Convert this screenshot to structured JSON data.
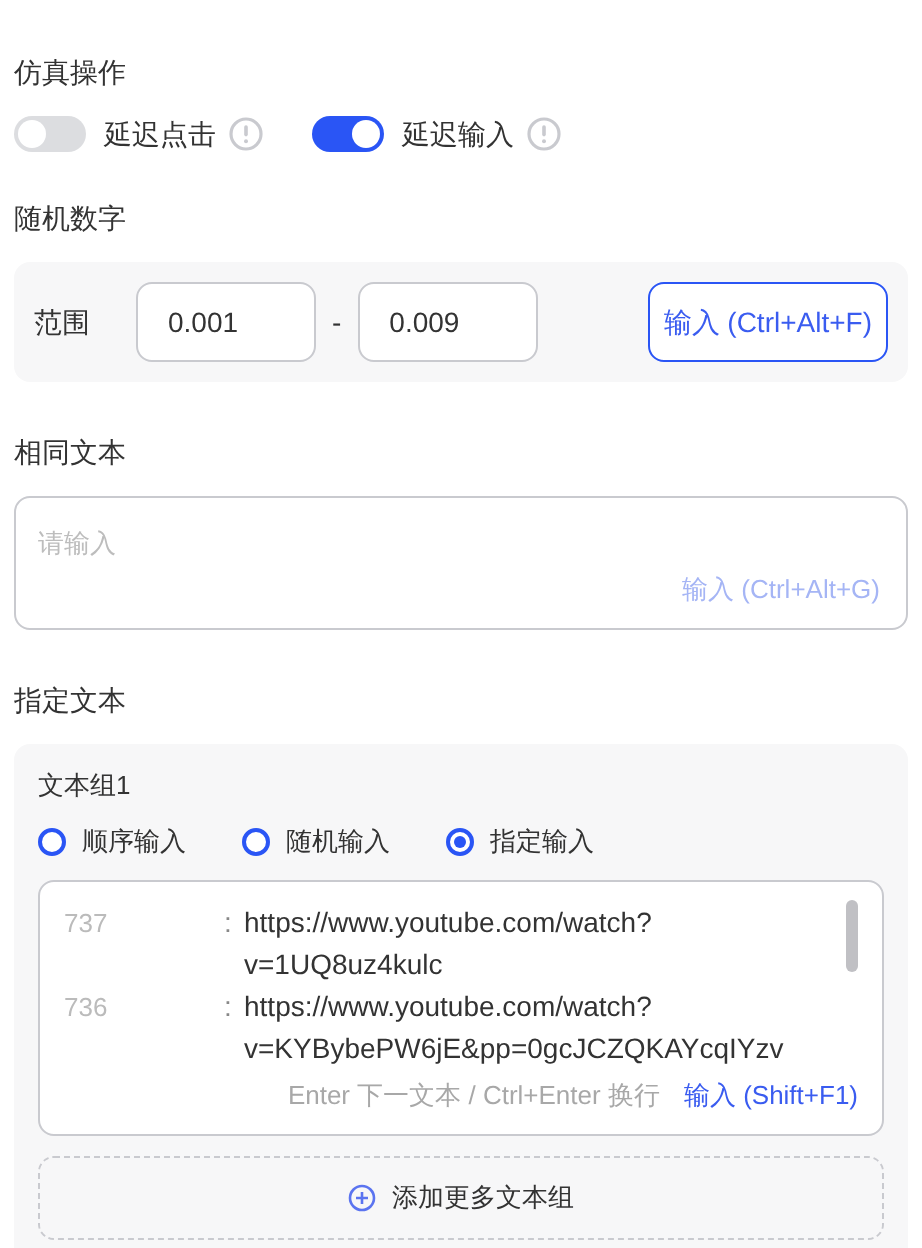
{
  "simulate": {
    "title": "仿真操作",
    "toggles": [
      {
        "label": "延迟点击",
        "on": false
      },
      {
        "label": "延迟输入",
        "on": true
      }
    ]
  },
  "random_number": {
    "title": "随机数字",
    "range_label": "范围",
    "min": "0.001",
    "separator": "-",
    "max": "0.009",
    "button": "输入 (Ctrl+Alt+F)"
  },
  "same_text": {
    "title": "相同文本",
    "placeholder": "请输入",
    "button": {
      "label": "输入 (Ctrl+Alt+G)",
      "disabled": true
    }
  },
  "specified_text": {
    "title": "指定文本",
    "group": {
      "title": "文本组1",
      "modes": [
        {
          "label": "顺序输入",
          "selected": false
        },
        {
          "label": "随机输入",
          "selected": false
        },
        {
          "label": "指定输入",
          "selected": true
        }
      ],
      "entries": [
        {
          "number": "737",
          "separator": ":",
          "text": "https://www.youtube.com/watch?v=1UQ8uz4kulc"
        },
        {
          "number": "736",
          "separator": ":",
          "text": "https://www.youtube.com/watch?v=KYBybePW6jE&pp=0gcJCZQKAYcqIYzv"
        }
      ],
      "hint": "Enter 下一文本 / Ctrl+Enter 换行",
      "button": "输入 (Shift+F1)"
    },
    "add_button": "添加更多文本组"
  }
}
